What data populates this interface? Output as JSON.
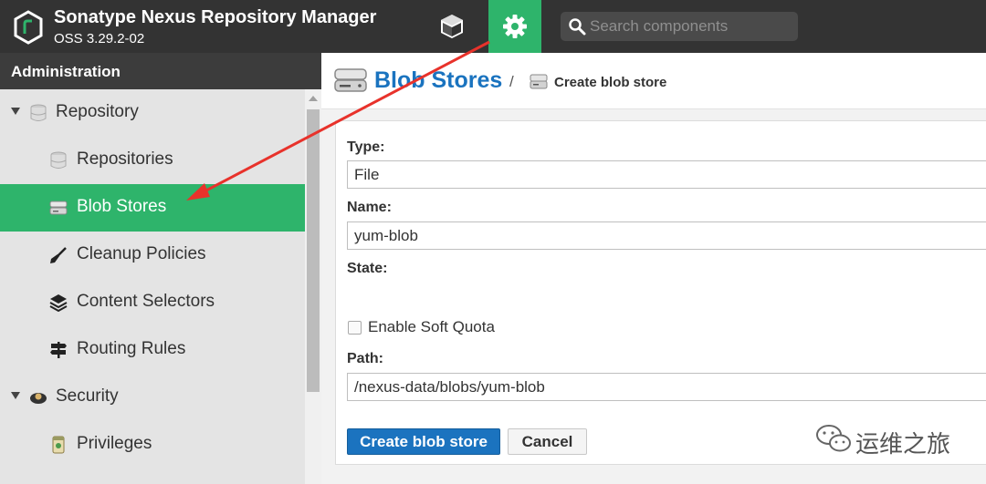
{
  "header": {
    "app_title": "Sonatype Nexus Repository Manager",
    "version": "OSS 3.29.2-02",
    "search_placeholder": "Search components"
  },
  "sidebar": {
    "title": "Administration",
    "items": [
      {
        "label": "Repository",
        "icon": "database-icon",
        "expanded": true,
        "level": 0
      },
      {
        "label": "Repositories",
        "icon": "database-icon",
        "level": 1
      },
      {
        "label": "Blob Stores",
        "icon": "server-icon",
        "level": 1,
        "active": true
      },
      {
        "label": "Cleanup Policies",
        "icon": "broom-icon",
        "level": 1
      },
      {
        "label": "Content Selectors",
        "icon": "layers-icon",
        "level": 1
      },
      {
        "label": "Routing Rules",
        "icon": "signpost-icon",
        "level": 1
      },
      {
        "label": "Security",
        "icon": "security-icon",
        "expanded": true,
        "level": 0
      },
      {
        "label": "Privileges",
        "icon": "badge-icon",
        "level": 1
      }
    ]
  },
  "breadcrumb": {
    "title": "Blob Stores",
    "separator": "/",
    "current": "Create blob store"
  },
  "form": {
    "type_label": "Type:",
    "type_value": "File",
    "name_label": "Name:",
    "name_value": "yum-blob",
    "state_label": "State:",
    "soft_quota_label": "Enable Soft Quota",
    "soft_quota_checked": false,
    "path_label": "Path:",
    "path_value": "/nexus-data/blobs/yum-blob",
    "submit_label": "Create blob store",
    "cancel_label": "Cancel"
  },
  "watermark": {
    "text": "运维之旅"
  },
  "colors": {
    "accent_green": "#2eb46b",
    "link_blue": "#1a73bf",
    "header_dark": "#333333",
    "annotation_arrow": "#e8322b"
  }
}
